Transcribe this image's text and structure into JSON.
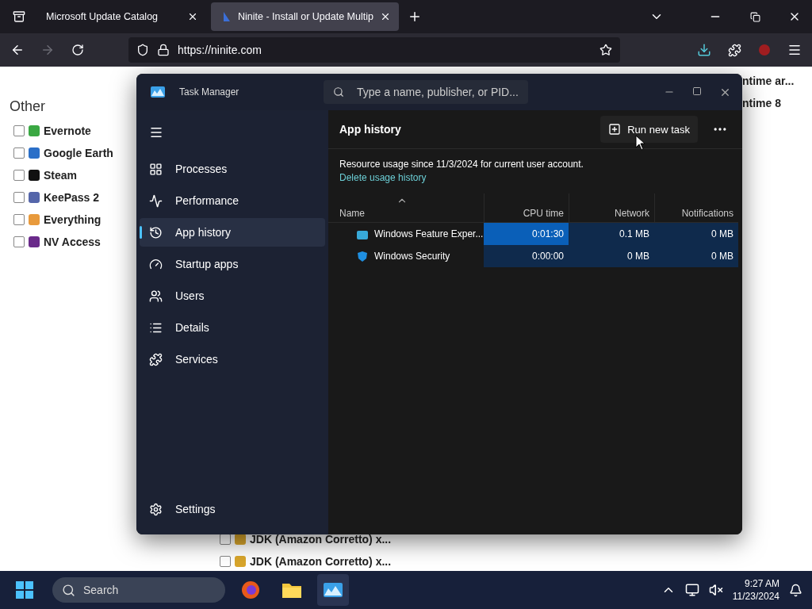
{
  "browser": {
    "tabs": [
      {
        "title": "Microsoft Update Catalog",
        "selected": false
      },
      {
        "title": "Ninite - Install or Update Multip",
        "selected": true
      }
    ],
    "url": "https://ninite.com"
  },
  "page": {
    "section_title": "Other",
    "items": [
      {
        "label": "Evernote",
        "checked": false
      },
      {
        "label": "Google Earth",
        "checked": false
      },
      {
        "label": "Steam",
        "checked": false
      },
      {
        "label": "KeePass 2",
        "checked": false
      },
      {
        "label": "Everything",
        "checked": false
      },
      {
        "label": "NV Access",
        "checked": false
      }
    ],
    "right_fragments": [
      "ntime ar...",
      "ntime 8"
    ],
    "bottom_items": [
      {
        "label": "JDK (Amazon Corretto) x...",
        "checked": false
      },
      {
        "label": "JDK (Amazon Corretto) x...",
        "checked": false
      }
    ]
  },
  "task_manager": {
    "title": "Task Manager",
    "search": {
      "placeholder": "Type a name, publisher, or PID..."
    },
    "nav": [
      {
        "label": "Processes",
        "selected": false
      },
      {
        "label": "Performance",
        "selected": false
      },
      {
        "label": "App history",
        "selected": true
      },
      {
        "label": "Startup apps",
        "selected": false
      },
      {
        "label": "Users",
        "selected": false
      },
      {
        "label": "Details",
        "selected": false
      },
      {
        "label": "Services",
        "selected": false
      }
    ],
    "settings": "Settings",
    "heading": "App history",
    "run_button": "Run new task",
    "description": "Resource usage since 11/3/2024 for current user account.",
    "link": "Delete usage history",
    "columns": [
      "Name",
      "CPU time",
      "Network",
      "Notifications"
    ],
    "rows": [
      {
        "cells": [
          {
            "text": "Windows Feature Exper..."
          },
          {
            "text": "0:01:30",
            "color": "#0a5fb8"
          },
          {
            "text": "0.1 MB",
            "color": "#0f2a4c"
          },
          {
            "text": "0 MB",
            "color": "#0f2a4c"
          }
        ]
      },
      {
        "cells": [
          {
            "text": "Windows Security"
          },
          {
            "text": "0:00:00",
            "color": "#0f2a4c"
          },
          {
            "text": "0 MB",
            "color": "#0f2a4c"
          },
          {
            "text": "0 MB",
            "color": "#0f2a4c"
          }
        ]
      }
    ]
  },
  "taskbar": {
    "search": {
      "placeholder": "Search"
    },
    "time": "9:27 AM",
    "date": "11/23/2024"
  }
}
